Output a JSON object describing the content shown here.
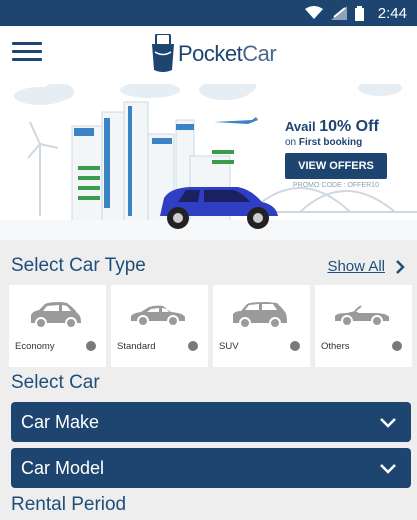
{
  "status_bar": {
    "time": "2:44"
  },
  "header": {
    "brand_part1": "Pocket",
    "brand_part2": "Car"
  },
  "offer": {
    "avail": "Avail ",
    "percent": "10% Off",
    "on": "on ",
    "booking": "First booking",
    "button_label": "VIEW OFFERS",
    "promo": "PROMO CODE : OFFER10"
  },
  "car_type_section": {
    "title": "Select Car Type",
    "show_all": "Show All",
    "types": [
      {
        "label": "Economy",
        "icon": "hatchback-icon"
      },
      {
        "label": "Standard",
        "icon": "sedan-icon"
      },
      {
        "label": "SUV",
        "icon": "suv-icon"
      },
      {
        "label": "Others",
        "icon": "convertible-icon"
      }
    ]
  },
  "select_car_section": {
    "title": "Select Car",
    "make_label": "Car Make",
    "model_label": "Car Model"
  },
  "rental_section": {
    "title": "Rental Period"
  },
  "colors": {
    "primary": "#1d4570",
    "background": "#eeeeee",
    "accent": "#2f3fc4"
  }
}
